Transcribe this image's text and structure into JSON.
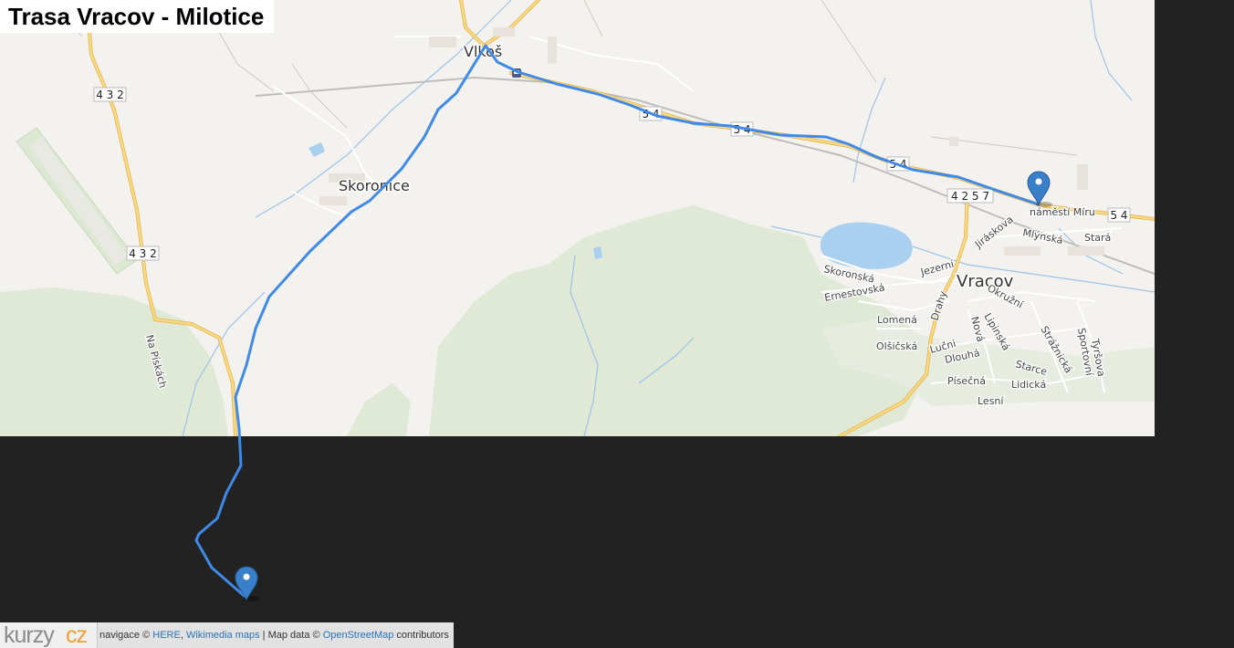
{
  "title": "Trasa Vracov - Milotice",
  "map": {
    "places": [
      {
        "name": "Vlkoš"
      },
      {
        "name": "Skoronice"
      },
      {
        "name": "Vracov"
      }
    ],
    "streets": [
      "náměstí Míru",
      "Jiráskova",
      "Mlýnská",
      "Stará",
      "Skoronská",
      "Jezerní",
      "Ernestovská",
      "Okružní",
      "Lomená",
      "Drahy",
      "Nová",
      "Lipinská",
      "Olšičská",
      "Lučni",
      "Dlouhá",
      "Strážnická",
      "Sportovní",
      "Tyršova",
      "Starce",
      "Lidická",
      "Písečná",
      "Lesní",
      "Na Pískách"
    ],
    "road_shields": [
      "432",
      "432",
      "54",
      "54",
      "54",
      "54",
      "4257"
    ],
    "markers": [
      "start-marker",
      "end-marker"
    ],
    "route_color": "#3f8ae8"
  },
  "attribution": {
    "logo_a": "kurzy",
    "logo_b": "cz",
    "navigace_prefix": "navigace © ",
    "link_here": "HERE",
    "sep1": ", ",
    "link_wikimedia": "Wikimedia maps",
    "sep2": " | Map data © ",
    "link_osm": "OpenStreetMap",
    "suffix": " contributors"
  }
}
